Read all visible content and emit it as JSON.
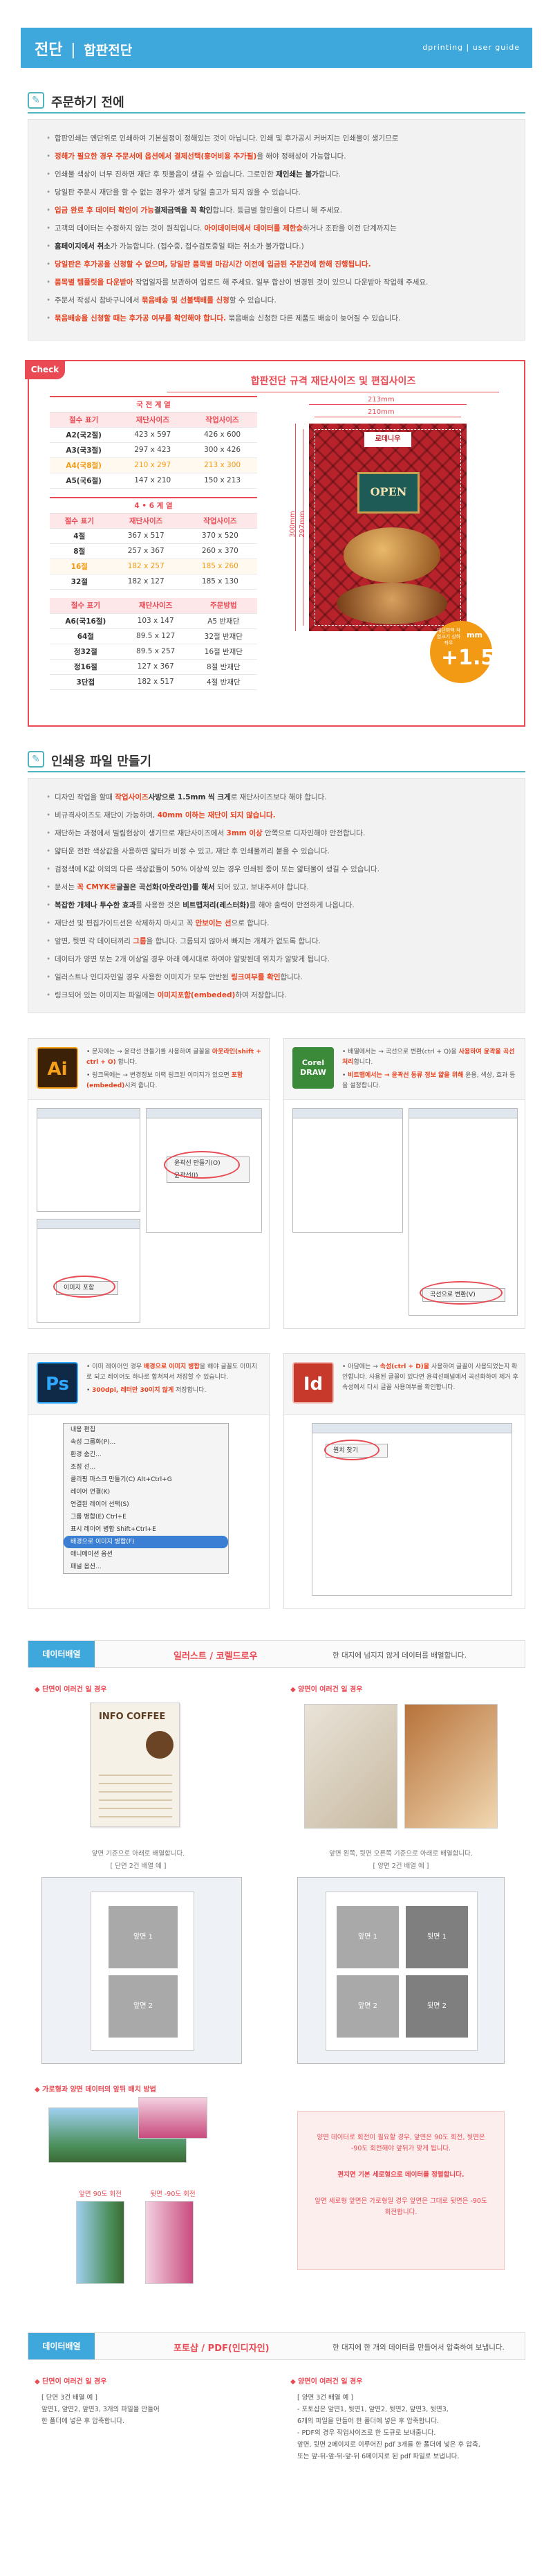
{
  "header": {
    "title_main": "전단",
    "title_sep": "|",
    "title_sub": "합판전단",
    "guide": "dprinting | user guide"
  },
  "section1": {
    "icon": "✎",
    "title": "주문하기 전에",
    "items": [
      {
        "pre": "합판인쇄는 옌단위로 인쇄하여 기본설정이 정해있는 것이 아닙니다. 인쇄 및 후가공시 커버지는 인쇄물이 생기므로",
        "red": "",
        "post": ""
      },
      {
        "pre": "",
        "red": "정해가 필요한 경우 주문서에 옵션에서 결제선택(흥어비용 추가필)",
        "post": "을 해야 정해성이 가능합니다."
      },
      {
        "pre": "인쇄물 색상이 너무 진하면 재단 후 핏물음이 생길 수 있습니다. 그로인한 ",
        "red": "",
        "bold": "재인쇄는 불가",
        "post": "합니다."
      },
      {
        "pre": "당일판 주문시 재단을 할 수 없는 경우가 생겨 당일 출고가 되지 않을 수 있습니다.",
        "red": "",
        "post": ""
      },
      {
        "pre": "",
        "red": "입금 완료 후 데이터 확인이 가능",
        "post": "합니다. 등급별 할인율이 다르니 ",
        "bold": "결제금액을 꼭 확인",
        "post2": "해 주세요."
      },
      {
        "pre": "고객의 데이터는 수정하지 않는 것이 원칙입니다. ",
        "red": "아이데이터에서 데이터를 제한승",
        "post": "하거나 조판을 이전 단계까지는"
      },
      {
        "pre": "",
        "bold": "홈페이지에서 취소",
        "post": "가 가능합니다. (접수중, 접수검토중일 때는 취소가 불가합니다.)"
      },
      {
        "pre": "",
        "red": "당일판은 후가공을 신청할 수 없으며, 당일판 품목별 마감시간 이전에 입금된 주문건에 한해 진행됩니다.",
        "post": ""
      },
      {
        "pre": "",
        "red": "품목별 템플릿을 다운받아",
        "post": " 작업일자를 보관하여 업로드 해 주세요. 일부 합산이 변경된 것이 있으니 다운받아 작업해 주세요."
      },
      {
        "pre": "주문서 작성시 참바구니에서 ",
        "red": "묶음배송 및 선불택배를 신청",
        "post": "할 수 있습니다."
      },
      {
        "pre": "",
        "red": "묶음배송을 신청할 때는 후가공 여부를 확인해야 합니다.",
        "post": " 묶음배송 신청한 다른 제품도 배송이 늦어질 수 있습니다."
      }
    ]
  },
  "spec": {
    "badge": "Check",
    "title": "합판전단 규격 재단사이즈 및 편집사이즈",
    "table1": {
      "group": "국 전 계 열",
      "cols": [
        "절수 표기",
        "재단사이즈",
        "작업사이즈"
      ],
      "rows": [
        [
          "A2(국2절)",
          "423 x 597",
          "426 x 600"
        ],
        [
          "A3(국3절)",
          "297 x 423",
          "300 x 426"
        ],
        [
          "A4(국8절)",
          "210 x 297",
          "213 x 300"
        ],
        [
          "A5(국6절)",
          "147 x 210",
          "150 x 213"
        ]
      ]
    },
    "table2": {
      "group": "4 • 6 계 열",
      "cols": [
        "절수 표기",
        "재단사이즈",
        "작업사이즈"
      ],
      "rows": [
        [
          "4절",
          "367 x 517",
          "370 x 520"
        ],
        [
          "8절",
          "257 x 367",
          "260 x 370"
        ],
        [
          "16절",
          "182 x 257",
          "185 x 260"
        ],
        [
          "32절",
          "182 x 127",
          "185 x 130"
        ]
      ]
    },
    "table3": {
      "cols": [
        "절수 표기",
        "재단사이즈",
        "주문방법"
      ],
      "rows": [
        [
          "A6(국16절)",
          "103 x 147",
          "A5 반재단"
        ],
        [
          "64절",
          "89.5 x 127",
          "32절 반재단"
        ],
        [
          "정32절",
          "89.5 x 257",
          "16절 반재단"
        ],
        [
          "정16절",
          "127 x 367",
          "8절 반재단"
        ],
        [
          "3단접",
          "182 x 517",
          "4절 반재단"
        ]
      ]
    },
    "mock_logo": "로데니우",
    "mock_sign": "OPEN",
    "dim_w1": "213mm",
    "dim_w2": "210mm",
    "dim_h1": "300mm",
    "dim_h2": "297mm",
    "plus_small": "재단여백 작업크기 상하좌우",
    "plus_mm": "mm",
    "plus_big": "+1.5"
  },
  "section2": {
    "icon": "✎",
    "title": "인쇄용 파일 만들기",
    "items": [
      {
        "pre": "디자인 작업을 할때 ",
        "red": "작업사이즈",
        "post": "로 재단사이즈보다 ",
        "bold": "사방으로 1.5mm 씩 크게",
        "post2": " 해야 합니다."
      },
      {
        "pre": "비규격사이즈도 재단이 가능하며, ",
        "red": "40mm 이하는 재단이 되지 않습니다.",
        "post": ""
      },
      {
        "pre": "재단하는 과정에서 밀림현상이 생기므로 재단사이즈에서 ",
        "red": "3mm 이상",
        "post": " 안쪽으로 디자인해야 안전합니다."
      },
      {
        "pre": "얇터운 전판 색상값을 사용하면 얇터가 비정 수 있고, 재단 후 인쇄물끼리 붙을 수 있습니다.",
        "red": "",
        "post": ""
      },
      {
        "pre": "검정색에 K값 이외의 다른 색상값들이 50% 이상씩 있는 경우 인쇄된 종이 또는 얇터물이 생길 수 있습니다.",
        "red": "",
        "post": ""
      },
      {
        "pre": "문서는 ",
        "red": "꼭 CMYK로",
        "post": " 되어 있고, ",
        "bold": "글꼴은 곡선화(아웃라인)를 해서",
        "post2": " 보내주셔야 합니다."
      },
      {
        "pre": "",
        "bold": "복잡한 개체나 투수한 효과",
        "post": "를 사용한 것은 ",
        "bold2": "비트맵처리(레스터화)",
        "post2": "를 해야 출력이 안전하게 나옵니다."
      },
      {
        "pre": "재단선 및 편집가이드선은 삭제하지 마시고 꼭 ",
        "red": "안보이는 선",
        "post": "으로 합니다."
      },
      {
        "pre": "앞면, 뒷면 각 데이터끼리 ",
        "red": "그룹",
        "post": "을 합니다. 그룹되지 않아서 빠지는 개체가 없도록 합니다."
      },
      {
        "pre": "데이터가 양면 또는 2개 이상일 경우 아래 예시대로 하여야 알맞된데 위치가 알맞게 됩니다.",
        "red": "",
        "post": ""
      },
      {
        "pre": "일러스트나 인디자인일 경우 사용한 이미지가 모두 안반된 ",
        "red": "링크여부를 확인",
        "post": "합니다."
      },
      {
        "pre": "링크되어 있는 이미지는 파일에는 ",
        "red": "이미지포함(embeded)",
        "post": "하여 저장합니다."
      }
    ]
  },
  "illustrator": {
    "icon": "Ai",
    "lines": [
      {
        "pre": "문자에는 → 윤곽선 만들기를 사용하여 글꼴을 ",
        "red": "아웃라인(shift + ctrl + O)",
        "post": " 합니다."
      },
      {
        "pre": "링크목에는 → 변경정보 이력 링크된 이미지가 있으면 ",
        "red": "포함(embeded)",
        "post": "시켜 줍니다."
      }
    ],
    "menu1": [
      "윤곽선 만들기(O)",
      "윤곽선(I)"
    ],
    "menu2": [
      "이미지 포함"
    ]
  },
  "coreldraw": {
    "icon": "Corel DRAW",
    "lines": [
      {
        "pre": "배열에서는 → 곡선으로 변환(ctrl + Q)을 ",
        "red": "사용하여 윤곽을 곡선처리",
        "post": "합니다."
      },
      {
        "pre": "",
        "red": "비트맵에서는 → 윤곽선 동류 정보 얇을 위해",
        "post": " 윤용, 색상, 효과 등을 설정합니다."
      }
    ],
    "menu": [
      "곡선으로 변환(V)"
    ]
  },
  "photoshop": {
    "icon": "Ps",
    "lines": [
      {
        "pre": "이미 레이어인 경우 ",
        "red": "배경으로 이미지 병합",
        "post": "을 해야 글꼴도 이미지로 되고 레이어도 하나로 합쳐져서 저장할 수 있습니다."
      },
      {
        "pre": "",
        "red": "300dpi, 레터만 30이지 않게",
        "post": " 저장합니다."
      }
    ],
    "menu": [
      "내용 편집",
      "속성 그룹화(P)...",
      "환경 숨긴...",
      "조정 선...",
      "클리핑 마스크 만들기(C)   Alt+Ctrl+G",
      "레이어 연결(K)",
      "연결된 레이어 선택(S)",
      "그룹 병합(E)   Ctrl+E",
      "표시 레이어 병합   Shift+Ctrl+E",
      "배경으로 이미지 병합(F)",
      "애니메이션 옵션",
      "패널 옵션..."
    ]
  },
  "indesign": {
    "icon": "Id",
    "lines": [
      {
        "pre": "아담에는 → ",
        "red": "속성(ctrl + D)을",
        "post": " 사용하여 글꼴이 사용되었는지 확인합니다. 사용된 글꼴이 있다면 윤곽선패널에서 곡선화하여 제거 후 속성에서 다시 글꼴 사용여부를 확인합니다."
      }
    ],
    "menu": [
      "원치 찾기"
    ]
  },
  "data_ai": {
    "tag": "데이터배열",
    "t1": "일러스트 / 코렐드로우",
    "t2": "한 대지에 넘지지 않게 데이터를 배열합니다.",
    "single_label": "단면이 여러건 일 경우",
    "double_label": "양면이 여러건 일 경우",
    "single_caption": "앞면 기준으로 아래로 배열합니다.",
    "single_caption2": "[ 단면 2건 배열 예 ]",
    "double_caption": "앞면 왼쪽, 뒷면 오른쪽 기준으로 아래로 배열합니다.",
    "double_caption2": "[ 양면 2건 배열 예 ]",
    "infographic_title": "INFO COFFEE",
    "slot_front1": "앞면 1",
    "slot_front2": "앞면 2",
    "slot_back1": "뒷면 1",
    "slot_back2": "뒷면 2",
    "rotate_label": "가로형과 양면 데이터의 앞뒤 배치 방법",
    "rotate_a": "앞면 90도 회전",
    "rotate_b": "뒷면 -90도 회전",
    "note1": "양면 데이터로 회전이 필요할 경우, 앞면은 90도 회전, 뒷면은 -90도 회전해야 앞뒤가 맞게 됩니다.",
    "note2": "편지면 기본 세로형으로 데이터를 정렬합니다.",
    "note3": "앞면 세로형 앞면은 가로형일 경우 앞면은 그대로 뒷면은 -90도 회전합니다."
  },
  "data_pdf": {
    "tag": "데이터배열",
    "t1": "포토샵 / PDF(인디자인)",
    "t2": "한 대지에 한 개의 데이터를 만들어서 압축하여 보냅니다.",
    "single_label": "단면이 여러건 일 경우",
    "double_label": "양면이 여러건 일 경우",
    "single_lines": [
      "[ 단면 3건 배열 예 ]",
      "앞면1, 앞면2, 앞면3, 3개의 파일을 만들어",
      "한 폴더에 넣은 후 압축합니다."
    ],
    "double_lines": [
      "[ 양면 3건 배열 예 ]",
      "- 포토샵은 앞면1, 뒷면1, 앞면2, 뒷면2, 앞면3, 뒷면3,",
      "  6개의 파일을 만들어 한 폴더에 넣은 후 압축합니다.",
      "- PDF의 경우 작업사이즈로 한 도큐로 보내줍니다.",
      "  앞면, 뒷면 2페이지로 이루어진 pdf 3개를 한 폴더에 넣은 후 압축,",
      "  또는 앞-뒤-앞-뒤-앞-뒤 6페이지로 된 pdf 파일로 보냅니다."
    ]
  }
}
